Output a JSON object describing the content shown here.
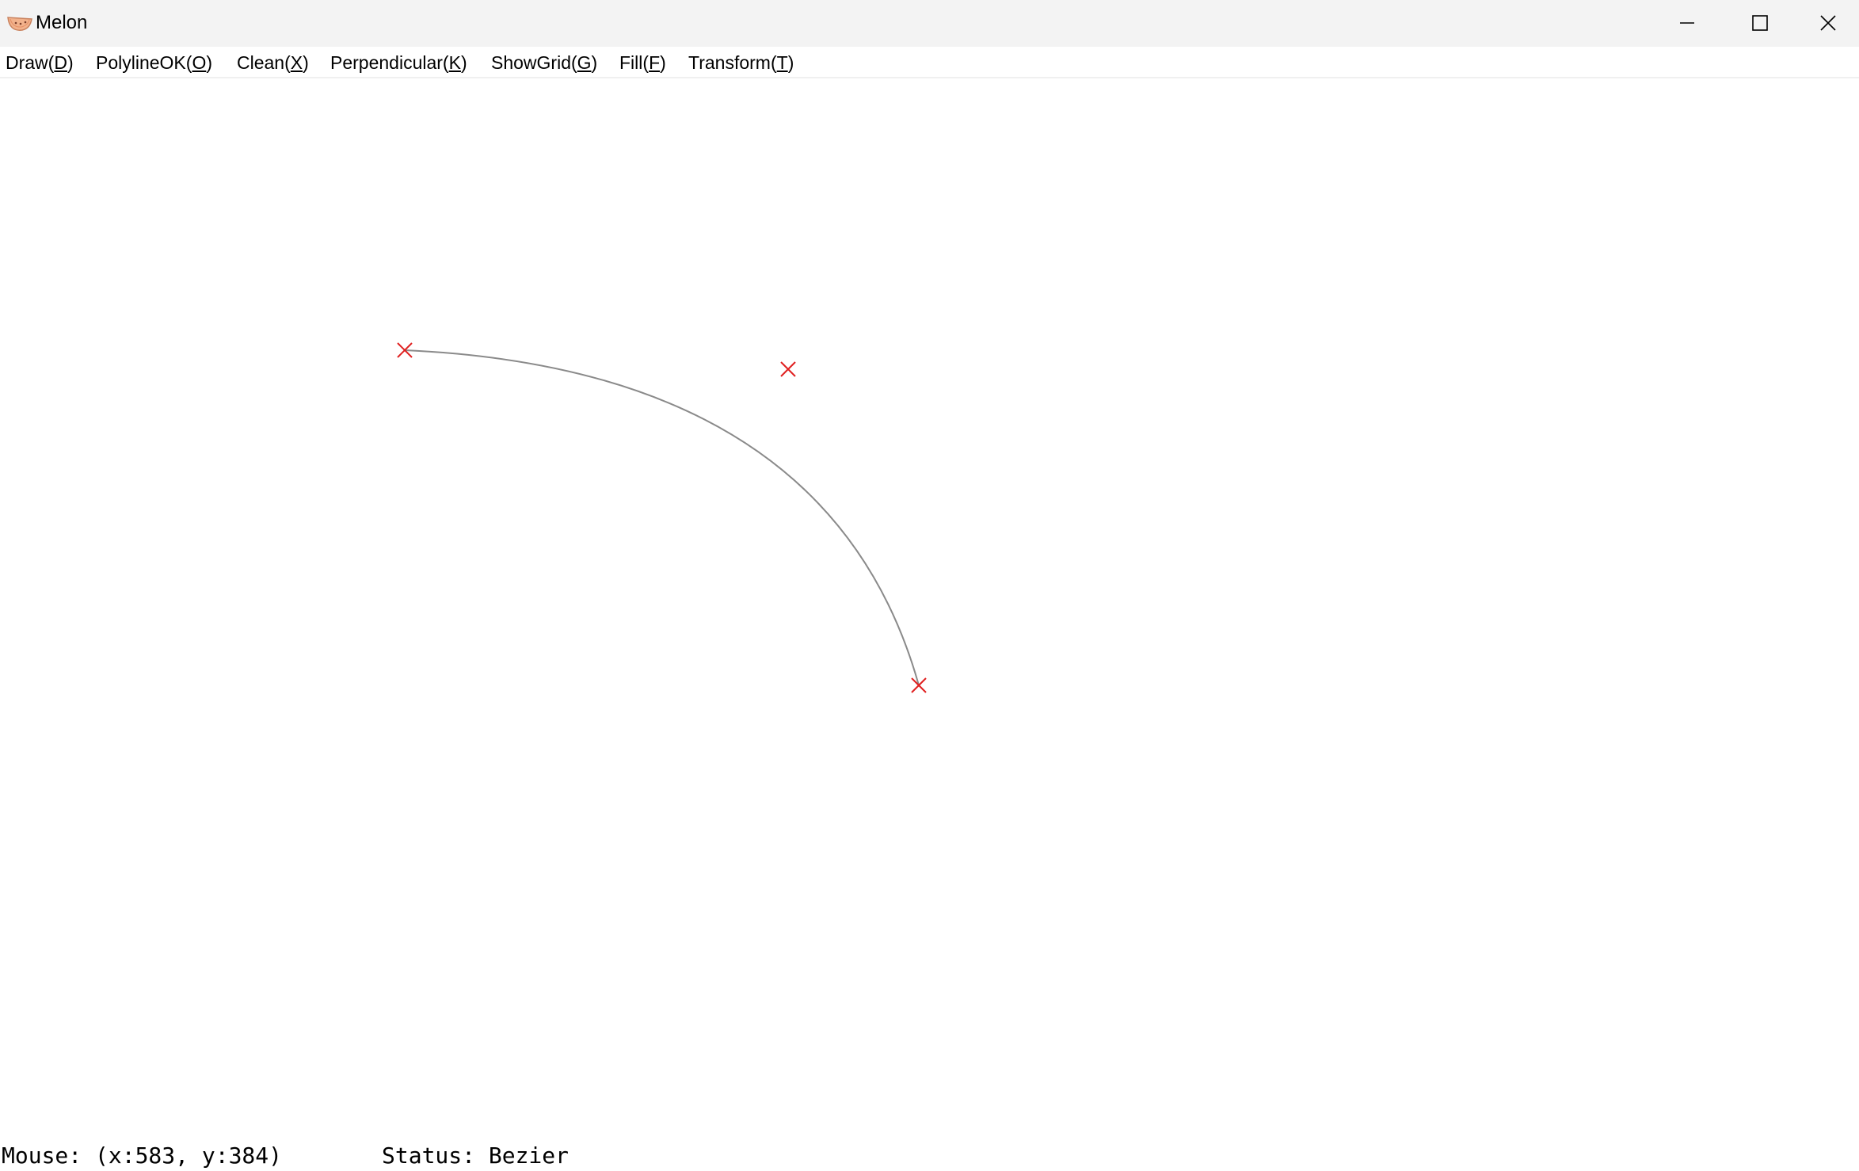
{
  "window": {
    "title": "Melon",
    "icon": "melon-slice-icon",
    "controls": [
      "minimize-icon",
      "maximize-icon",
      "close-icon"
    ]
  },
  "menu": {
    "items": [
      {
        "label": "Draw",
        "accel": "D"
      },
      {
        "label": "PolylineOK",
        "accel": "O"
      },
      {
        "label": "Clean",
        "accel": "X"
      },
      {
        "label": "Perpendicular",
        "accel": "K"
      },
      {
        "label": "ShowGrid",
        "accel": "G"
      },
      {
        "label": "Fill",
        "accel": "F"
      },
      {
        "label": "Transform",
        "accel": "T"
      }
    ]
  },
  "canvas": {
    "shape": "bezier-curve",
    "marker_icon": "x-marker-icon",
    "curve_color": "#8a8a8a",
    "marker_color": "#e02020"
  },
  "statusbar": {
    "mouse_text": "Mouse: (x:583, y:384)",
    "status_text": "Status: Bezier"
  }
}
